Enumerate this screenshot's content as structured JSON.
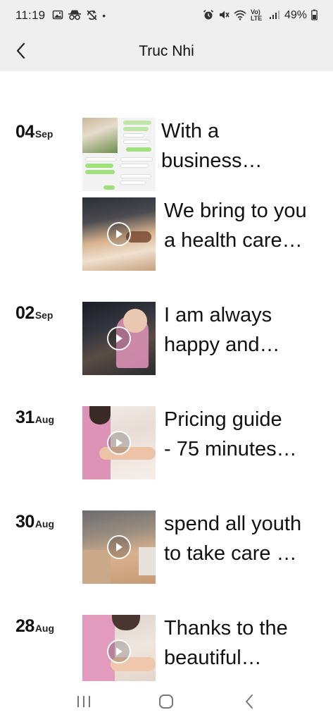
{
  "status_bar": {
    "time": "11:19",
    "dot": "•",
    "battery_percent": "49%",
    "network_label": "Vo) LTE",
    "left_icons": [
      "image-icon",
      "incognito-icon",
      "sync-off-icon"
    ],
    "right_icons": [
      "alarm-icon",
      "mute-icon",
      "wifi-icon",
      "signal-icon",
      "battery-icon"
    ]
  },
  "header": {
    "title": "Truc Nhi",
    "back_icon": "chevron-left-icon"
  },
  "timeline": [
    {
      "day": "04",
      "month": "Sep",
      "posts": [
        {
          "caption": "With a\nbusiness…",
          "thumb": "chat-collage",
          "video": false
        },
        {
          "caption": "We bring to you\na health care…",
          "thumb": "massage-bed",
          "video": true
        }
      ]
    },
    {
      "day": "02",
      "month": "Sep",
      "posts": [
        {
          "caption": "I am always\nhappy and…",
          "thumb": "therapist-dark-room",
          "video": true
        }
      ]
    },
    {
      "day": "31",
      "month": "Aug",
      "posts": [
        {
          "caption": "Pricing guide\n- 75 minutes…",
          "thumb": "leg-massage",
          "video": true
        }
      ]
    },
    {
      "day": "30",
      "month": "Aug",
      "posts": [
        {
          "caption": "spend all youth\nto take care …",
          "thumb": "hot-stone-back",
          "video": true
        }
      ]
    },
    {
      "day": "28",
      "month": "Aug",
      "posts": [
        {
          "caption": "Thanks to the\nbeautiful…",
          "thumb": "pink-uniform-massage",
          "video": true
        }
      ]
    }
  ],
  "nav_bar": {
    "buttons": [
      "recent-apps-icon",
      "home-icon",
      "back-icon"
    ]
  },
  "colors": {
    "header_bg": "#efefef",
    "page_bg": "#ffffff",
    "text": "#111111"
  }
}
